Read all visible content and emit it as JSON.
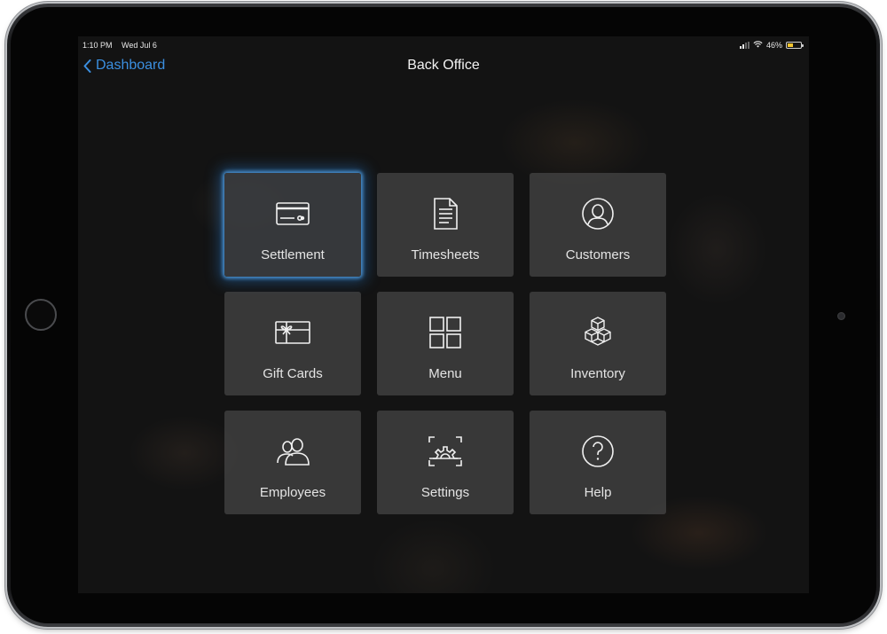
{
  "status_bar": {
    "time": "1:10 PM",
    "date": "Wed Jul 6",
    "battery_percent": "46%",
    "battery_level": 0.46,
    "battery_color": "#f2c530"
  },
  "nav": {
    "back_label": "Dashboard",
    "title": "Back Office",
    "accent_color": "#3b8fe0"
  },
  "tiles": [
    {
      "label": "Settlement",
      "icon": "credit-card-icon",
      "selected": true
    },
    {
      "label": "Timesheets",
      "icon": "document-icon",
      "selected": false
    },
    {
      "label": "Customers",
      "icon": "user-circle-icon",
      "selected": false
    },
    {
      "label": "Gift Cards",
      "icon": "gift-card-icon",
      "selected": false
    },
    {
      "label": "Menu",
      "icon": "grid-icon",
      "selected": false
    },
    {
      "label": "Inventory",
      "icon": "boxes-icon",
      "selected": false
    },
    {
      "label": "Employees",
      "icon": "people-icon",
      "selected": false
    },
    {
      "label": "Settings",
      "icon": "gear-icon",
      "selected": false
    },
    {
      "label": "Help",
      "icon": "question-circle-icon",
      "selected": false
    }
  ]
}
